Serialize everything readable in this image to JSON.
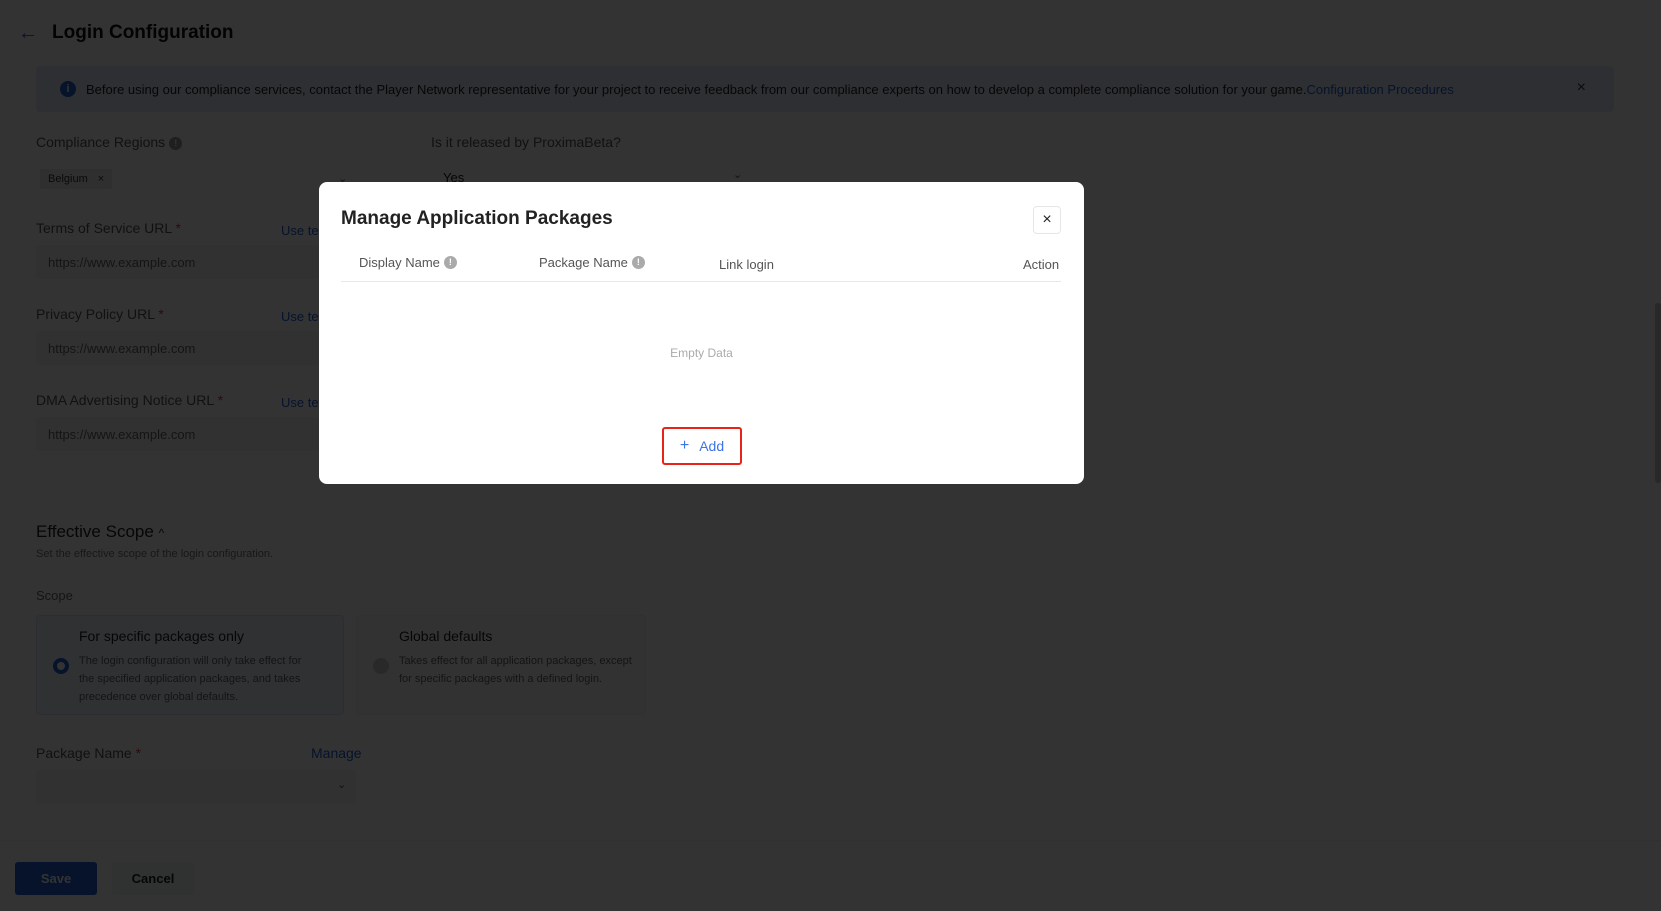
{
  "header": {
    "title": "Login Configuration",
    "back_icon": "arrow-left-icon"
  },
  "alert": {
    "text": "Before using our compliance services, contact the Player Network representative for your project to receive feedback from our compliance experts on how to develop a complete compliance solution for your game.",
    "link": "Configuration Procedures",
    "info_icon": "i",
    "close_icon": "×"
  },
  "form": {
    "compliance_regions": {
      "label": "Compliance Regions",
      "tags": [
        "Belgium"
      ]
    },
    "released_by": {
      "label": "Is it released by ProximaBeta?",
      "value": "Yes"
    },
    "terms_of_service": {
      "label": "Terms of Service URL",
      "placeholder": "https://www.example.com",
      "link": "Use te"
    },
    "privacy_policy": {
      "label": "Privacy Policy URL",
      "placeholder": "https://www.example.com",
      "link": "Use te"
    },
    "dma_notice": {
      "label": "DMA Advertising Notice URL",
      "placeholder": "https://www.example.com",
      "link": "Use te"
    },
    "required_mark": "*"
  },
  "effective_scope": {
    "title": "Effective Scope",
    "description": "Set the effective scope of the login configuration.",
    "scope_label": "Scope",
    "options": [
      {
        "title": "For specific packages only",
        "description": "The login configuration will only take effect for the specified application packages, and takes precedence over global defaults.",
        "selected": true
      },
      {
        "title": "Global defaults",
        "description": "Takes effect for all application packages, except for specific packages with a defined login.",
        "selected": false
      }
    ],
    "package_name": {
      "label": "Package Name",
      "manage_link": "Manage",
      "value": ""
    }
  },
  "footer": {
    "save": "Save",
    "cancel": "Cancel"
  },
  "modal": {
    "title": "Manage Application Packages",
    "close": "×",
    "columns": [
      "Display Name",
      "Package Name",
      "Link login",
      "Action"
    ],
    "rows": [],
    "empty_text": "Empty Data",
    "add_button": "Add",
    "add_icon": "+"
  }
}
